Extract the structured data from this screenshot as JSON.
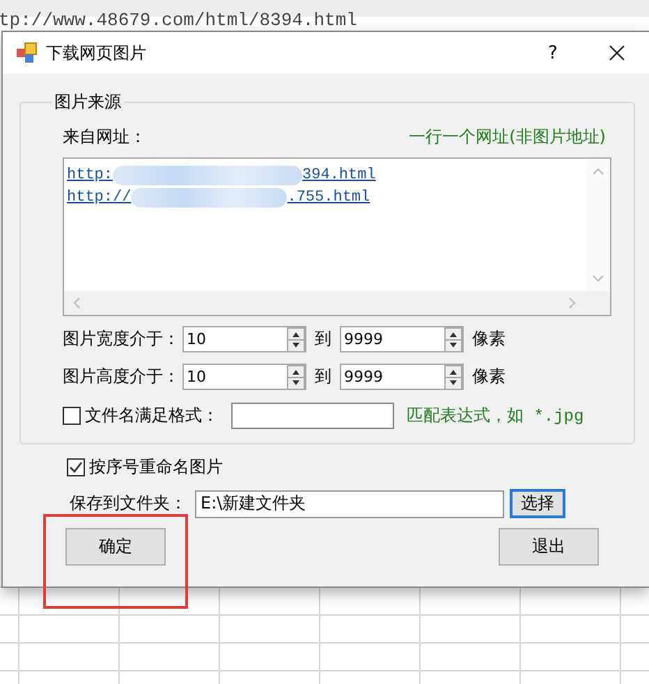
{
  "background": {
    "address_text": "tp://www.48679.com/html/8394.html"
  },
  "dialog": {
    "title": "下载网页图片",
    "help": "?"
  },
  "source_group": {
    "legend": "图片来源",
    "url_label": "来自网址：",
    "url_hint": "一行一个网址(非图片地址)",
    "urls": [
      {
        "start": "http:",
        "end": "394.html"
      },
      {
        "start": "http://",
        "end": ".755.html"
      }
    ],
    "ranges": [
      {
        "label": "图片宽度介于：",
        "min": "10",
        "to": "到",
        "max": "9999",
        "unit": "像素"
      },
      {
        "label": "图片高度介于：",
        "min": "10",
        "to": "到",
        "max": "9999",
        "unit": "像素"
      }
    ],
    "name_filter": {
      "checked": false,
      "label": "文件名满足格式：",
      "hint": "匹配表达式，如 *.jpg"
    }
  },
  "rename": {
    "checked": true,
    "label": "按序号重命名图片"
  },
  "save": {
    "label": "保存到文件夹：",
    "value": "E:\\新建文件夹",
    "browse": "选择"
  },
  "buttons": [
    {
      "label": "确定",
      "highlighted": true
    },
    {
      "label": "退出",
      "highlighted": false
    }
  ]
}
